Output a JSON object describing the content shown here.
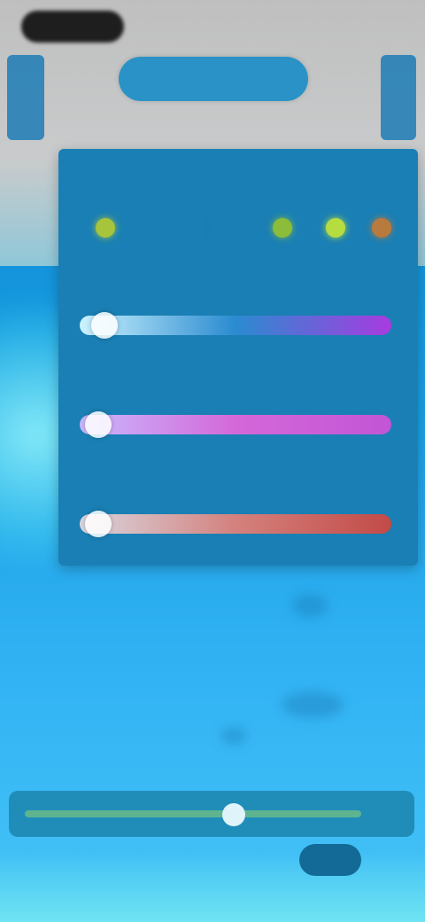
{
  "topbar": {
    "search_placeholder": ""
  },
  "panel": {
    "sections": [
      {
        "label": "",
        "value": "",
        "swatches": [
          "#a6c43c",
          "#1a7fb4",
          "#8bbd3a",
          "#b6dd3f",
          "#b97a3d"
        ]
      },
      {
        "label": "",
        "value": "",
        "gradient": [
          "#ccf3ff",
          "#2a8bd0",
          "#a83be0"
        ],
        "level": 0.08
      },
      {
        "label": "",
        "value": "",
        "gradient": [
          "#c9b9ff",
          "#d468d8",
          "#c255d6"
        ],
        "level": 0.06
      },
      {
        "label": "",
        "value": "",
        "gradient": [
          "#d9d7e0",
          "#d4817d",
          "#c24a47"
        ],
        "level": 0.06
      }
    ]
  },
  "bottom": {
    "progress": 0.62,
    "button_label": ""
  },
  "colors": {
    "panel_bg": "#1a7fb4",
    "background_top": "#c9cbcc",
    "background_bottom": "#46c4f6"
  }
}
